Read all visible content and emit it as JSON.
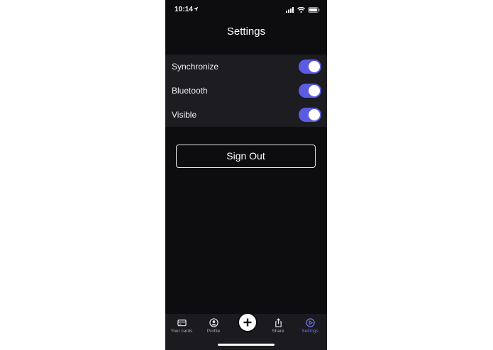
{
  "status_bar": {
    "time": "10:14"
  },
  "header": {
    "title": "Settings"
  },
  "settings": [
    {
      "label": "Synchronize",
      "enabled": true
    },
    {
      "label": "Bluetooth",
      "enabled": true
    },
    {
      "label": "Visible",
      "enabled": true
    }
  ],
  "actions": {
    "sign_out_label": "Sign Out"
  },
  "tab_bar": {
    "items": [
      {
        "label": "Your cards",
        "icon": "card-icon",
        "active": false
      },
      {
        "label": "Profile",
        "icon": "user-icon",
        "active": false
      },
      {
        "label": "",
        "icon": "plus-icon",
        "active": false
      },
      {
        "label": "Share",
        "icon": "share-icon",
        "active": false
      },
      {
        "label": "Settings",
        "icon": "play-circle-icon",
        "active": true
      }
    ]
  },
  "colors": {
    "background": "#0d0d0f",
    "group_background": "#1c1c21",
    "accent": "#5b5ce2",
    "active_tab": "#6f6ff0"
  }
}
